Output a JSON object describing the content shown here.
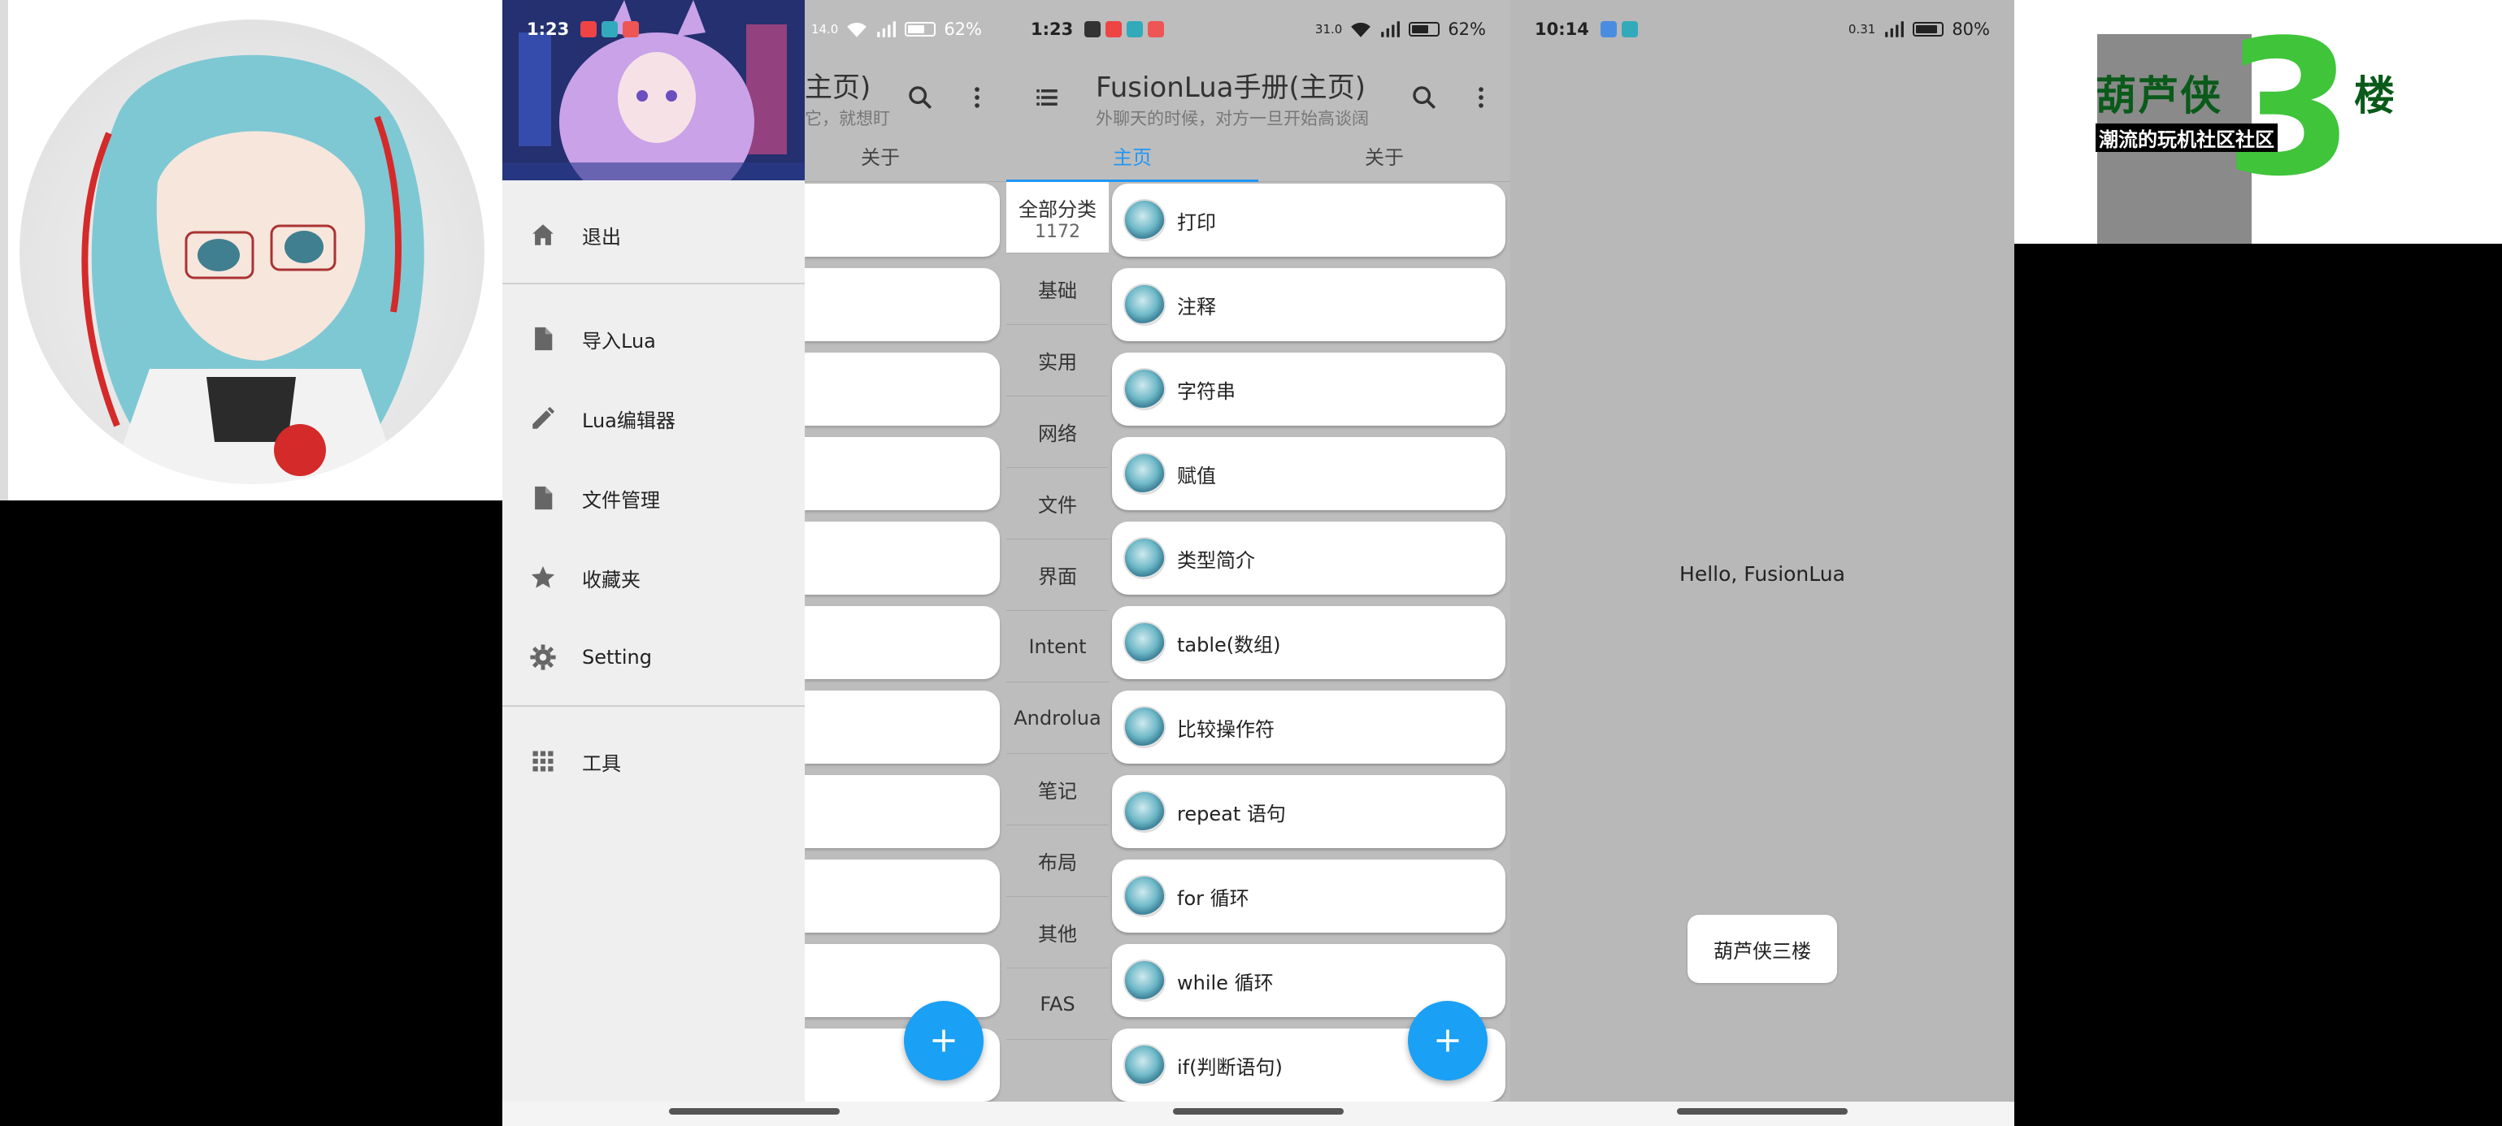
{
  "drawer_screen": {
    "status": {
      "time": "1:23",
      "battery": "62%",
      "speed": "14.0"
    },
    "toolbar_partial_title": "主页)",
    "toolbar_partial_sub": "它，就想盯",
    "tab_about": "关于",
    "menu": [
      {
        "label": "退出",
        "icon": "home-icon"
      },
      {
        "label": "导入Lua",
        "icon": "file-icon"
      },
      {
        "label": "Lua编辑器",
        "icon": "pencil-icon"
      },
      {
        "label": "文件管理",
        "icon": "file-icon"
      },
      {
        "label": "收藏夹",
        "icon": "star-icon"
      },
      {
        "label": "Setting",
        "icon": "gear-icon"
      },
      {
        "label": "工具",
        "icon": "apps-grid-icon"
      }
    ]
  },
  "main_screen": {
    "status": {
      "time": "1:23",
      "battery": "62%",
      "speed": "31.0"
    },
    "toolbar": {
      "title": "FusionLua手册(主页)",
      "subtitle": "外聊天的时候，对方一旦开始高谈阔"
    },
    "tabs": [
      "主页",
      "关于"
    ],
    "categories": [
      {
        "name": "全部分类",
        "count": "1172"
      },
      {
        "name": "基础"
      },
      {
        "name": "实用"
      },
      {
        "name": "网络"
      },
      {
        "name": "文件"
      },
      {
        "name": "界面"
      },
      {
        "name": "Intent"
      },
      {
        "name": "Androlua"
      },
      {
        "name": "笔记"
      },
      {
        "name": "布局"
      },
      {
        "name": "其他"
      },
      {
        "name": "FAS"
      }
    ],
    "items": [
      "打印",
      "注释",
      "字符串",
      "赋值",
      "类型简介",
      "table(数组)",
      "比较操作符",
      "repeat 语句",
      "for 循环",
      "while 循环",
      "if(判断语句)"
    ]
  },
  "hello_screen": {
    "status": {
      "time": "10:14",
      "battery": "80%",
      "speed": "0.31"
    },
    "message": "Hello, FusionLua",
    "button": "葫芦侠三楼"
  },
  "logo": {
    "title": "葫芦侠",
    "big_digit": "3",
    "suffix": "楼",
    "subtitle": "潮流的玩机社区社区"
  },
  "colors": {
    "accent": "#2196f3",
    "fab": "#1aa0f5",
    "logo_green": "#3fc43a"
  }
}
